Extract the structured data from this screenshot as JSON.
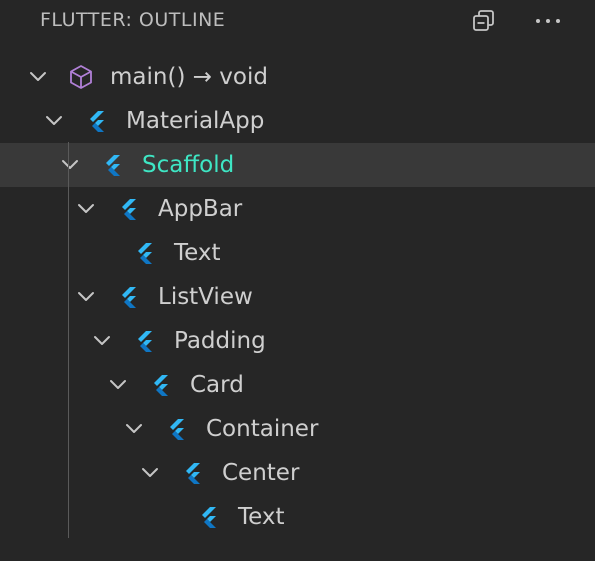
{
  "header": {
    "title": "FLUTTER: OUTLINE",
    "collapse_icon": "collapse-all-icon",
    "more_icon": "more-actions-icon"
  },
  "colors": {
    "background": "#262626",
    "selected_row": "#393939",
    "selected_text": "#3ee6c4",
    "text": "#cfcfcf",
    "flutter_blue": "#31b8f5",
    "method_purple": "#b180d7"
  },
  "tree": [
    {
      "label": "main() → void",
      "icon": "method-icon",
      "depth": 0,
      "expanded": true
    },
    {
      "label": "MaterialApp",
      "icon": "flutter-icon",
      "depth": 1,
      "expanded": true
    },
    {
      "label": "Scaffold",
      "icon": "flutter-icon",
      "depth": 2,
      "expanded": true,
      "selected": true
    },
    {
      "label": "AppBar",
      "icon": "flutter-icon",
      "depth": 3,
      "expanded": true
    },
    {
      "label": "Text",
      "icon": "flutter-icon",
      "depth": 4,
      "leaf": true
    },
    {
      "label": "ListView",
      "icon": "flutter-icon",
      "depth": 3,
      "expanded": true
    },
    {
      "label": "Padding",
      "icon": "flutter-icon",
      "depth": 4,
      "expanded": true
    },
    {
      "label": "Card",
      "icon": "flutter-icon",
      "depth": 5,
      "expanded": true
    },
    {
      "label": "Container",
      "icon": "flutter-icon",
      "depth": 6,
      "expanded": true
    },
    {
      "label": "Center",
      "icon": "flutter-icon",
      "depth": 7,
      "expanded": true
    },
    {
      "label": "Text",
      "icon": "flutter-icon",
      "depth": 8,
      "leaf": true
    }
  ]
}
